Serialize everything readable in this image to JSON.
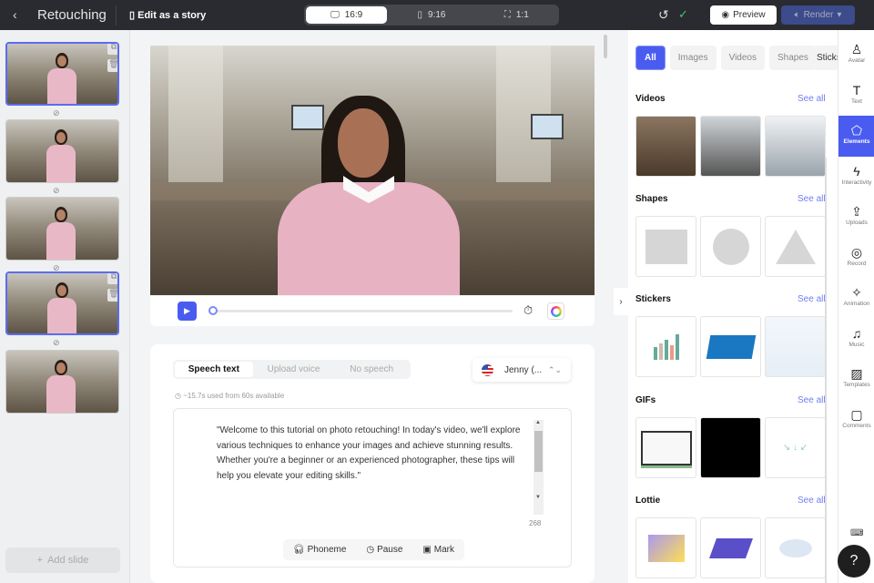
{
  "header": {
    "back": "‹",
    "title": "Retouching",
    "edit_story": "Edit as a story",
    "ratios": [
      {
        "label": "16:9",
        "icon": "monitor-icon"
      },
      {
        "label": "9:16",
        "icon": "phone-icon"
      },
      {
        "label": "1:1",
        "icon": "square-frame-icon"
      }
    ],
    "undo": "↺",
    "saved": "✓",
    "preview": "Preview",
    "render": "Render"
  },
  "slides": {
    "count": 5,
    "selected": [
      0,
      3
    ],
    "add_slide": "Add slide"
  },
  "player": {
    "progress": 0
  },
  "speech": {
    "tabs": [
      "Speech text",
      "Upload voice",
      "No speech"
    ],
    "active_tab": 0,
    "voice": "Jenny (...",
    "usage": "~15.7s used from 60s available",
    "text": "\"Welcome to this tutorial on photo retouching! In today's video, we'll explore various techniques to enhance your images and achieve stunning results. Whether you're a beginner or an experienced photographer, these tips will help you elevate your editing skills.\"",
    "char_count": "268",
    "tools": [
      "Phoneme",
      "Pause",
      "Mark"
    ]
  },
  "elements": {
    "tabs": [
      "All",
      "Images",
      "Videos",
      "Shapes",
      "Stick"
    ],
    "sections": [
      {
        "title": "Videos",
        "see_all": "See all"
      },
      {
        "title": "Shapes",
        "see_all": "See all"
      },
      {
        "title": "Stickers",
        "see_all": "See all"
      },
      {
        "title": "GIFs",
        "see_all": "See all"
      },
      {
        "title": "Lottie",
        "see_all": "See all"
      }
    ]
  },
  "rail": [
    {
      "label": "Avatar",
      "icon": "avatar-icon"
    },
    {
      "label": "Text",
      "icon": "text-icon"
    },
    {
      "label": "Elements",
      "icon": "elements-icon"
    },
    {
      "label": "Interactivity",
      "icon": "interactivity-icon"
    },
    {
      "label": "Uploads",
      "icon": "upload-icon"
    },
    {
      "label": "Record",
      "icon": "record-icon"
    },
    {
      "label": "Animation",
      "icon": "animation-icon"
    },
    {
      "label": "Music",
      "icon": "music-icon"
    },
    {
      "label": "Templates",
      "icon": "templates-icon"
    },
    {
      "label": "Comments",
      "icon": "comments-icon"
    }
  ],
  "help": "?",
  "colors": {
    "accent": "#4a5cf0",
    "topbar": "#2a2b30",
    "render": "#3c4b8c"
  }
}
